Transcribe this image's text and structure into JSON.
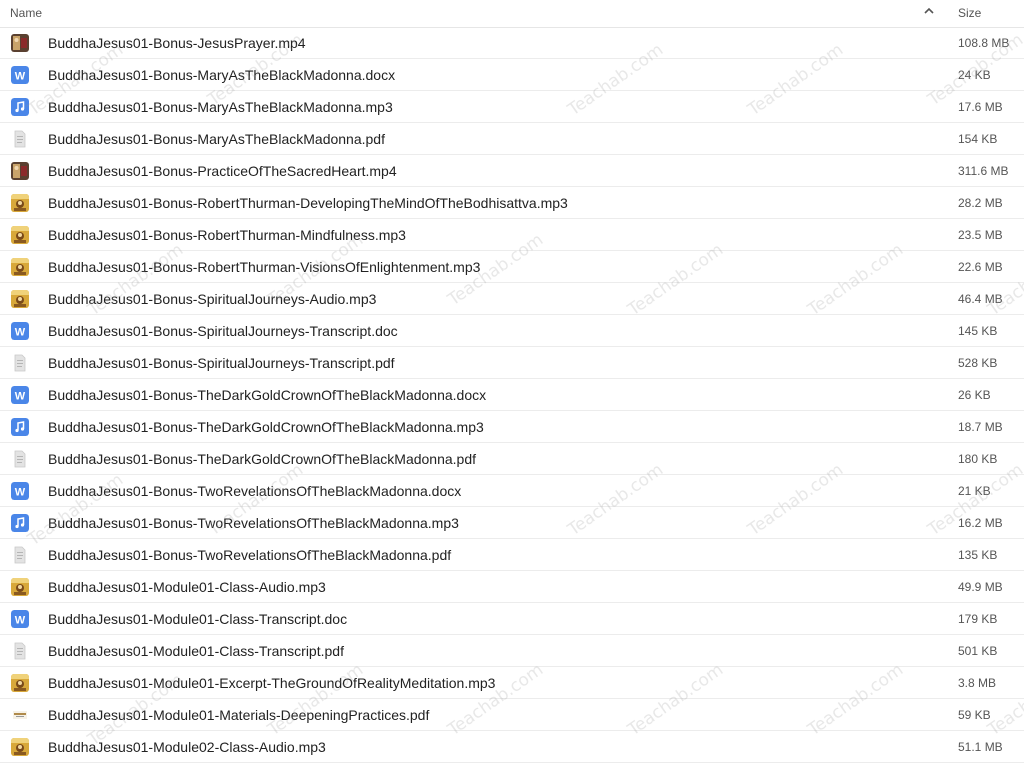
{
  "header": {
    "name_label": "Name",
    "size_label": "Size",
    "sort_icon": "chevron-up-icon"
  },
  "files": [
    {
      "name": "BuddhaJesus01-Bonus-JesusPrayer.mp4",
      "size": "108.8 MB",
      "icon": "video-thumbnail-icon"
    },
    {
      "name": "BuddhaJesus01-Bonus-MaryAsTheBlackMadonna.docx",
      "size": "24 KB",
      "icon": "word-doc-icon"
    },
    {
      "name": "BuddhaJesus01-Bonus-MaryAsTheBlackMadonna.mp3",
      "size": "17.6 MB",
      "icon": "audio-icon"
    },
    {
      "name": "BuddhaJesus01-Bonus-MaryAsTheBlackMadonna.pdf",
      "size": "154 KB",
      "icon": "pdf-icon"
    },
    {
      "name": "BuddhaJesus01-Bonus-PracticeOfTheSacredHeart.mp4",
      "size": "311.6 MB",
      "icon": "video-thumbnail-icon"
    },
    {
      "name": "BuddhaJesus01-Bonus-RobertThurman-DevelopingTheMindOfTheBodhisattva.mp3",
      "size": "28.2 MB",
      "icon": "album-art-icon"
    },
    {
      "name": "BuddhaJesus01-Bonus-RobertThurman-Mindfulness.mp3",
      "size": "23.5 MB",
      "icon": "album-art-icon"
    },
    {
      "name": "BuddhaJesus01-Bonus-RobertThurman-VisionsOfEnlightenment.mp3",
      "size": "22.6 MB",
      "icon": "album-art-icon"
    },
    {
      "name": "BuddhaJesus01-Bonus-SpiritualJourneys-Audio.mp3",
      "size": "46.4 MB",
      "icon": "album-art-icon"
    },
    {
      "name": "BuddhaJesus01-Bonus-SpiritualJourneys-Transcript.doc",
      "size": "145 KB",
      "icon": "word-doc-icon"
    },
    {
      "name": "BuddhaJesus01-Bonus-SpiritualJourneys-Transcript.pdf",
      "size": "528 KB",
      "icon": "pdf-icon"
    },
    {
      "name": "BuddhaJesus01-Bonus-TheDarkGoldCrownOfTheBlackMadonna.docx",
      "size": "26 KB",
      "icon": "word-doc-icon"
    },
    {
      "name": "BuddhaJesus01-Bonus-TheDarkGoldCrownOfTheBlackMadonna.mp3",
      "size": "18.7 MB",
      "icon": "audio-icon"
    },
    {
      "name": "BuddhaJesus01-Bonus-TheDarkGoldCrownOfTheBlackMadonna.pdf",
      "size": "180 KB",
      "icon": "pdf-icon"
    },
    {
      "name": "BuddhaJesus01-Bonus-TwoRevelationsOfTheBlackMadonna.docx",
      "size": "21 KB",
      "icon": "word-doc-icon"
    },
    {
      "name": "BuddhaJesus01-Bonus-TwoRevelationsOfTheBlackMadonna.mp3",
      "size": "16.2 MB",
      "icon": "audio-icon"
    },
    {
      "name": "BuddhaJesus01-Bonus-TwoRevelationsOfTheBlackMadonna.pdf",
      "size": "135 KB",
      "icon": "pdf-icon"
    },
    {
      "name": "BuddhaJesus01-Module01-Class-Audio.mp3",
      "size": "49.9 MB",
      "icon": "album-art-icon"
    },
    {
      "name": "BuddhaJesus01-Module01-Class-Transcript.doc",
      "size": "179 KB",
      "icon": "word-doc-icon"
    },
    {
      "name": "BuddhaJesus01-Module01-Class-Transcript.pdf",
      "size": "501 KB",
      "icon": "pdf-icon"
    },
    {
      "name": "BuddhaJesus01-Module01-Excerpt-TheGroundOfRealityMeditation.mp3",
      "size": "3.8 MB",
      "icon": "album-art-icon"
    },
    {
      "name": "BuddhaJesus01-Module01-Materials-DeepeningPractices.pdf",
      "size": "59 KB",
      "icon": "pdf-thumbnail-icon"
    },
    {
      "name": "BuddhaJesus01-Module02-Class-Audio.mp3",
      "size": "51.1 MB",
      "icon": "album-art-icon"
    }
  ],
  "watermark": "Teachab.com",
  "colors": {
    "word_blue": "#4a86e8",
    "audio_blue": "#4a86e8",
    "pdf_gray": "#cfcfcf",
    "album_gold": "#d8a83a"
  }
}
